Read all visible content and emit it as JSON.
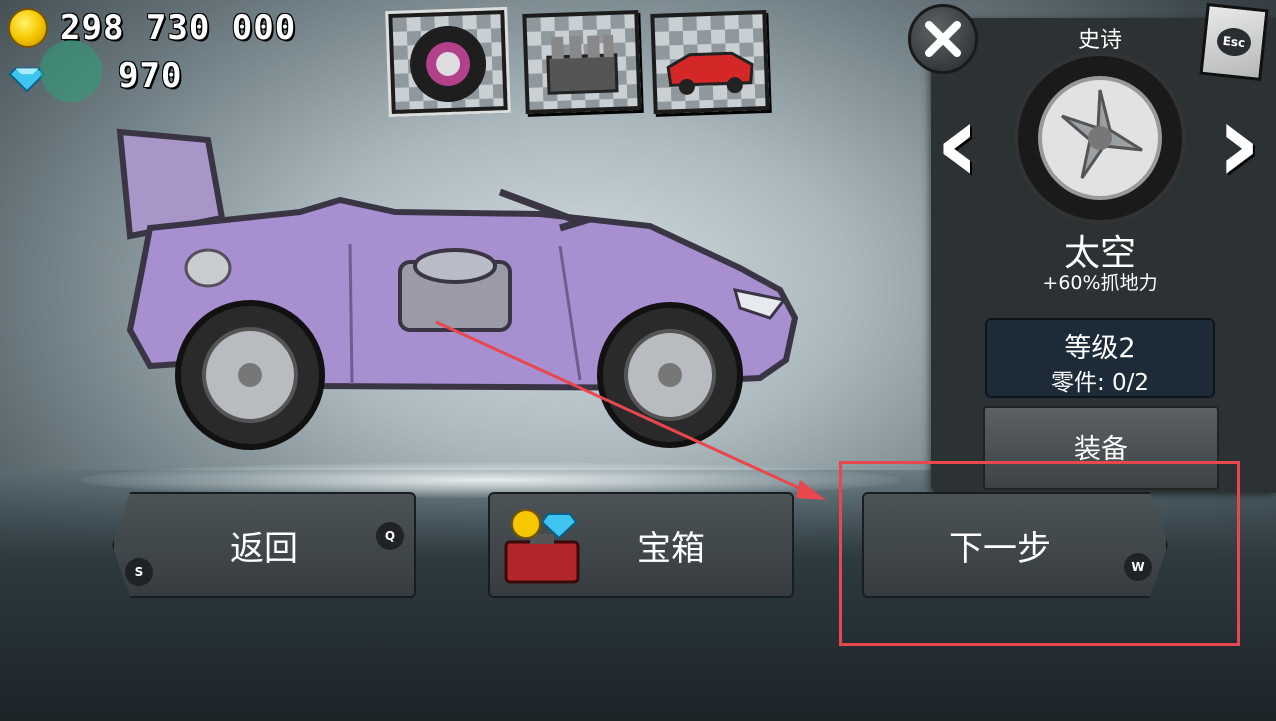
{
  "currency": {
    "coins": "298 730 000",
    "gems": "970"
  },
  "tabs": [
    {
      "name": "wheels",
      "icon": "tire-icon"
    },
    {
      "name": "engine",
      "icon": "engine-icon"
    },
    {
      "name": "body",
      "icon": "car-body-icon"
    }
  ],
  "panel": {
    "rarity": "史诗",
    "part_name": "太空",
    "part_bonus": "+60%抓地力",
    "level": "等级2",
    "parts": "零件: 0/2",
    "equip_label": "装备",
    "esc_key": "Esc"
  },
  "buttons": {
    "back_label": "返回",
    "back_key_q": "Q",
    "back_key_s": "S",
    "chest_label": "宝箱",
    "next_label": "下一步",
    "next_key": "W"
  },
  "colors": {
    "car_body": "#a78fd0",
    "highlight": "#e8474d",
    "panel_bg": "#2c3134",
    "level_bg": "#1d2b38"
  }
}
